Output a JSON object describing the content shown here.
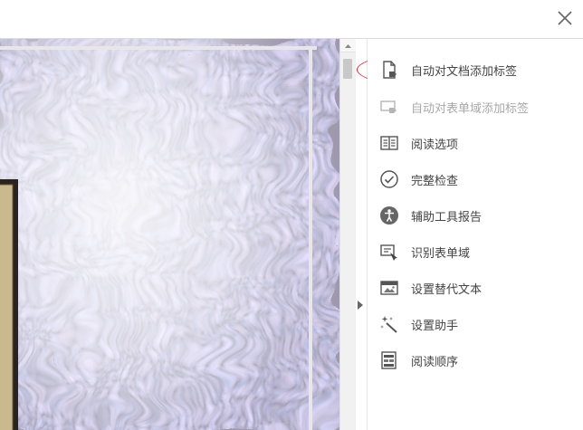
{
  "window": {
    "close_icon": "close-icon"
  },
  "document": {
    "pattern": "marbled-paper",
    "colors": {
      "base": "#f2eff5",
      "swirl_blue": "#5b63a8",
      "swirl_lavender": "#b7aed0",
      "swirl_brown": "#8a7158",
      "swirl_cream": "#d9ccb1"
    }
  },
  "tools": {
    "items": [
      {
        "label": "自动对文档添加标签",
        "icon": "document-tag-icon",
        "enabled": true,
        "highlighted": true
      },
      {
        "label": "自动对表单域添加标签",
        "icon": "form-field-tag-icon",
        "enabled": false
      },
      {
        "label": "阅读选项",
        "icon": "reading-options-icon",
        "enabled": true
      },
      {
        "label": "完整检查",
        "icon": "check-circle-icon",
        "enabled": true
      },
      {
        "label": "辅助工具报告",
        "icon": "accessibility-icon",
        "enabled": true
      },
      {
        "label": "识别表单域",
        "icon": "recognize-form-icon",
        "enabled": true
      },
      {
        "label": "设置替代文本",
        "icon": "alt-text-icon",
        "enabled": true
      },
      {
        "label": "设置助手",
        "icon": "wand-icon",
        "enabled": true
      },
      {
        "label": "阅读顺序",
        "icon": "reading-order-icon",
        "enabled": true
      }
    ]
  },
  "colors": {
    "highlight_ring": "#d6232a",
    "label_text": "#444444",
    "label_disabled": "#a8a8a8"
  }
}
